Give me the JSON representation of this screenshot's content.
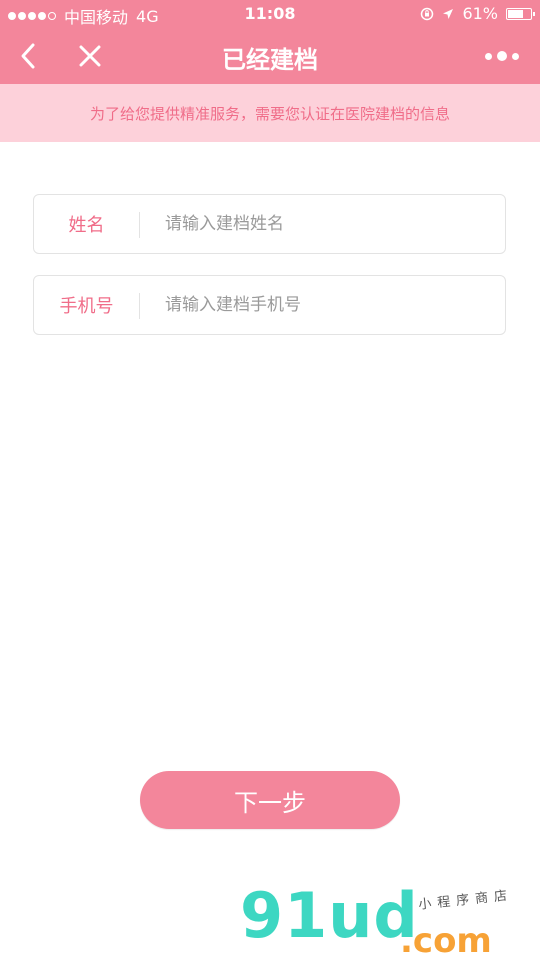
{
  "status_bar": {
    "carrier": "中国移动",
    "network": "4G",
    "time": "11:08",
    "battery_text": "61%",
    "battery_level": 0.61
  },
  "nav": {
    "title": "已经建档"
  },
  "notice": {
    "text": "为了给您提供精准服务，需要您认证在医院建档的信息"
  },
  "form": {
    "name_label": "姓名",
    "name_placeholder": "请输入建档姓名",
    "phone_label": "手机号",
    "phone_placeholder": "请输入建档手机号"
  },
  "next_button": "下一步",
  "watermark": {
    "logo": "91ud",
    "tagline": "小程序商店",
    "suffix": ".com"
  },
  "colors": {
    "primary": "#f3869b",
    "notice_bg": "#fdd1da",
    "accent_text": "#f06d89"
  }
}
